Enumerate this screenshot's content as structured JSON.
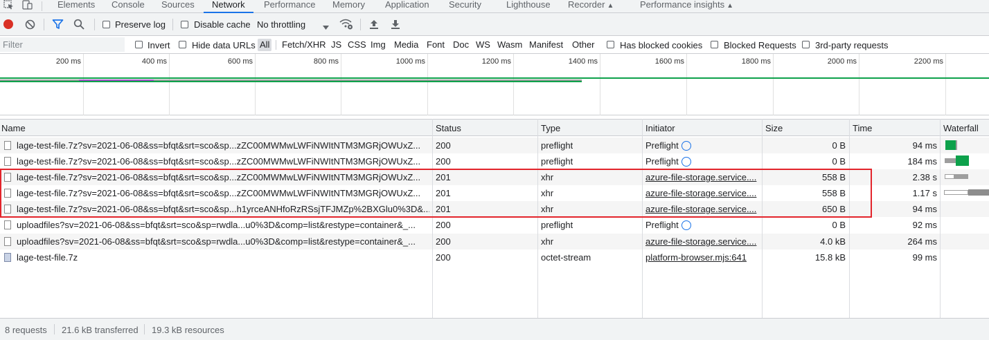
{
  "tabs": [
    "Elements",
    "Console",
    "Sources",
    "Network",
    "Performance",
    "Memory",
    "Application",
    "Security",
    "Lighthouse",
    "Recorder",
    "Performance insights"
  ],
  "toolbar": {
    "preserve_log": "Preserve log",
    "disable_cache": "Disable cache",
    "throttling": "No throttling"
  },
  "filter": {
    "placeholder": "Filter",
    "invert": "Invert",
    "hide_data_urls": "Hide data URLs",
    "types": [
      "All",
      "Fetch/XHR",
      "JS",
      "CSS",
      "Img",
      "Media",
      "Font",
      "Doc",
      "WS",
      "Wasm",
      "Manifest",
      "Other"
    ],
    "has_blocked_cookies": "Has blocked cookies",
    "blocked_requests": "Blocked Requests",
    "third_party": "3rd-party requests"
  },
  "overview": {
    "ticks": [
      "200 ms",
      "400 ms",
      "600 ms",
      "800 ms",
      "1000 ms",
      "1200 ms",
      "1400 ms",
      "1600 ms",
      "1800 ms",
      "2000 ms",
      "2200 ms"
    ]
  },
  "columns": {
    "name": "Name",
    "status": "Status",
    "type": "Type",
    "initiator": "Initiator",
    "size": "Size",
    "time": "Time",
    "waterfall": "Waterfall"
  },
  "rows": [
    {
      "name": "lage-test-file.7z?sv=2021-06-08&ss=bfqt&srt=sco&sp...zZC00MWMwLWFiNWItNTM3MGRjOWUxZ...",
      "status": "200",
      "type": "preflight",
      "initiator": "Preflight",
      "size": "0 B",
      "time": "94 ms"
    },
    {
      "name": "lage-test-file.7z?sv=2021-06-08&ss=bfqt&srt=sco&sp...zZC00MWMwLWFiNWItNTM3MGRjOWUxZ...",
      "status": "200",
      "type": "preflight",
      "initiator": "Preflight",
      "size": "0 B",
      "time": "184 ms"
    },
    {
      "name": "lage-test-file.7z?sv=2021-06-08&ss=bfqt&srt=sco&sp...zZC00MWMwLWFiNWItNTM3MGRjOWUxZ...",
      "status": "201",
      "type": "xhr",
      "initiator": "azure-file-storage.service....",
      "size": "558 B",
      "time": "2.38 s"
    },
    {
      "name": "lage-test-file.7z?sv=2021-06-08&ss=bfqt&srt=sco&sp...zZC00MWMwLWFiNWItNTM3MGRjOWUxZ...",
      "status": "201",
      "type": "xhr",
      "initiator": "azure-file-storage.service....",
      "size": "558 B",
      "time": "1.17 s"
    },
    {
      "name": "lage-test-file.7z?sv=2021-06-08&ss=bfqt&srt=sco&sp...h1yrceANHfoRzRSsjTFJMZp%2BXGlu0%3D&...",
      "status": "201",
      "type": "xhr",
      "initiator": "azure-file-storage.service....",
      "size": "650 B",
      "time": "94 ms"
    },
    {
      "name": "uploadfiles?sv=2021-06-08&ss=bfqt&srt=sco&sp=rwdla...u0%3D&comp=list&restype=container&_...",
      "status": "200",
      "type": "preflight",
      "initiator": "Preflight",
      "size": "0 B",
      "time": "92 ms"
    },
    {
      "name": "uploadfiles?sv=2021-06-08&ss=bfqt&srt=sco&sp=rwdla...u0%3D&comp=list&restype=container&_...",
      "status": "200",
      "type": "xhr",
      "initiator": "azure-file-storage.service....",
      "size": "4.0 kB",
      "time": "264 ms"
    },
    {
      "name": "lage-test-file.7z",
      "status": "200",
      "type": "octet-stream",
      "initiator": "platform-browser.mjs:641",
      "size": "15.8 kB",
      "time": "99 ms"
    }
  ],
  "status_bar": {
    "requests": "8 requests",
    "transferred": "21.6 kB transferred",
    "resources": "19.3 kB resources"
  },
  "colors": {
    "record": "#d93025",
    "accent": "#1a73e8",
    "highlight": "#e3242b",
    "waterfall_green": "#0da14b",
    "waterfall_gray": "#9e9e9e"
  }
}
